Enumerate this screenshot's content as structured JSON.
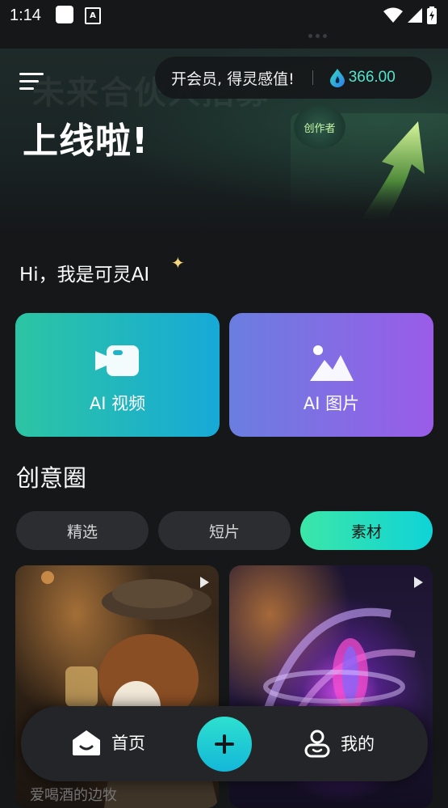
{
  "status_bar": {
    "time": "1:14"
  },
  "banner": {
    "background_text": "未来合伙人招募",
    "headline": "上线啦!",
    "badge": "创作者"
  },
  "member": {
    "promo_text": "开会员, 得灵感值!",
    "balance": "366.00"
  },
  "greeting": "Hi，我是可灵AI",
  "actions": [
    {
      "label": "AI 视频",
      "icon": "video-camera-icon"
    },
    {
      "label": "AI 图片",
      "icon": "image-mountain-icon"
    }
  ],
  "section": {
    "title": "创意圈",
    "tabs": [
      {
        "label": "精选",
        "active": false
      },
      {
        "label": "短片",
        "active": false
      },
      {
        "label": "素材",
        "active": true
      }
    ]
  },
  "feed": [
    {
      "caption": "爱喝酒的边牧",
      "icon": "play-icon"
    },
    {
      "caption": "",
      "icon": "play-icon"
    }
  ],
  "bottom_nav": {
    "home": "首页",
    "me": "我的"
  },
  "colors": {
    "background": "#151719",
    "accent_teal": "#54e3cb",
    "video_card": "#2cc5a3",
    "image_card": "#9a5ce8",
    "active_tab": "#3ce6a8"
  }
}
